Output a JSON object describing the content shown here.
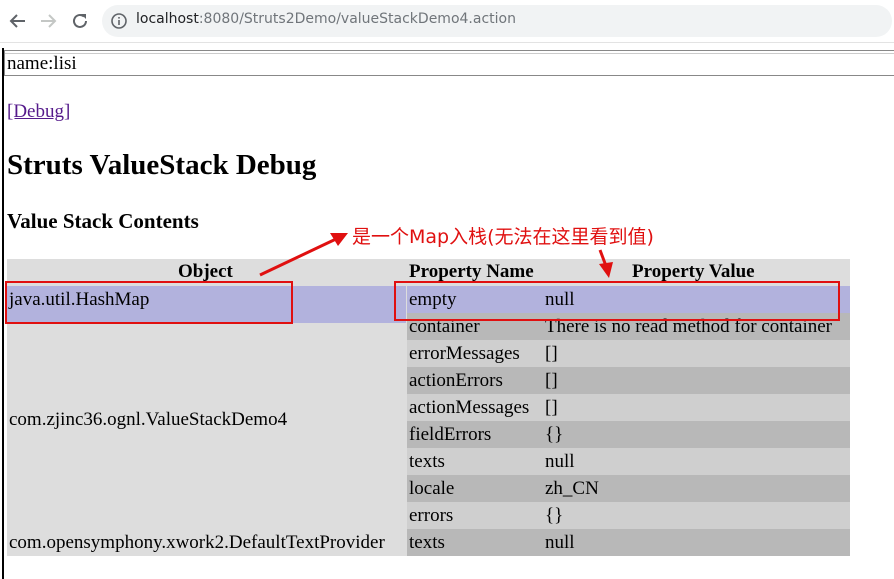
{
  "browser": {
    "url_host": "localhost",
    "url_rest": ":8080/Struts2Demo/valueStackDemo4.action"
  },
  "page": {
    "name_line": "name:lisi",
    "debug_link": "[Debug]",
    "title": "Struts ValueStack Debug",
    "subtitle": "Value Stack Contents",
    "headers": {
      "object": "Object",
      "property_name": "Property Name",
      "property_value": "Property Value"
    },
    "objects": [
      "java.util.HashMap",
      "com.zjinc36.ognl.ValueStackDemo4",
      "com.opensymphony.xwork2.DefaultTextProvider"
    ],
    "rows": [
      {
        "name": "empty",
        "value": "null"
      },
      {
        "name": "container",
        "value": "There is no read method for container"
      },
      {
        "name": "errorMessages",
        "value": "[]"
      },
      {
        "name": "actionErrors",
        "value": "[]"
      },
      {
        "name": "actionMessages",
        "value": "[]"
      },
      {
        "name": "fieldErrors",
        "value": "{}"
      },
      {
        "name": "texts",
        "value": "null"
      },
      {
        "name": "locale",
        "value": "zh_CN"
      },
      {
        "name": "errors",
        "value": "{}"
      },
      {
        "name": "texts",
        "value": "null"
      }
    ]
  },
  "annotation": {
    "text": "是一个Map入栈(无法在这里看到值)",
    "color": "#e01010"
  },
  "colors": {
    "highlight": "#b2b2dd",
    "row_light": "#cfcfcf",
    "row_dark": "#b8b8b8",
    "link": "#551a8b"
  },
  "icons": [
    "back-arrow-icon",
    "forward-arrow-icon",
    "reload-icon",
    "info-icon"
  ]
}
